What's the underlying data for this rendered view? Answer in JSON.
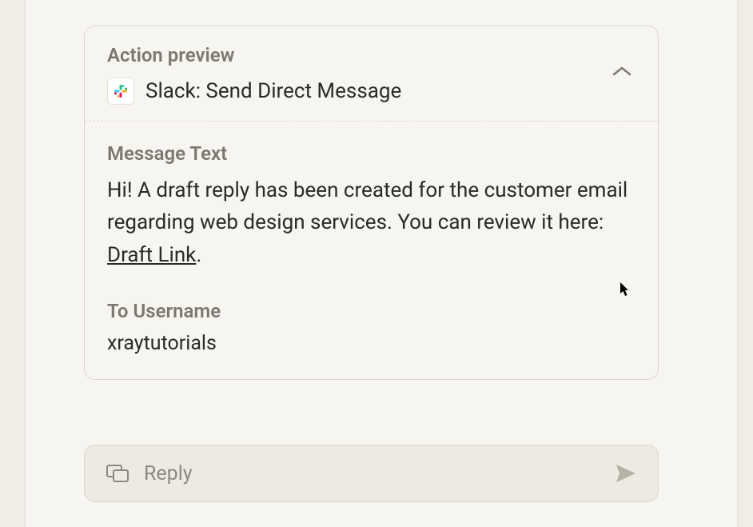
{
  "action_preview": {
    "label": "Action preview",
    "title": "Slack: Send Direct Message"
  },
  "message": {
    "label": "Message Text",
    "text_before_link": "Hi! A draft reply has been created for the customer email regarding web design services. You can review it here: ",
    "link_text": "Draft Link",
    "text_after_link": "."
  },
  "recipient": {
    "label": "To Username",
    "value": "xraytutorials"
  },
  "reply": {
    "placeholder": "Reply"
  }
}
